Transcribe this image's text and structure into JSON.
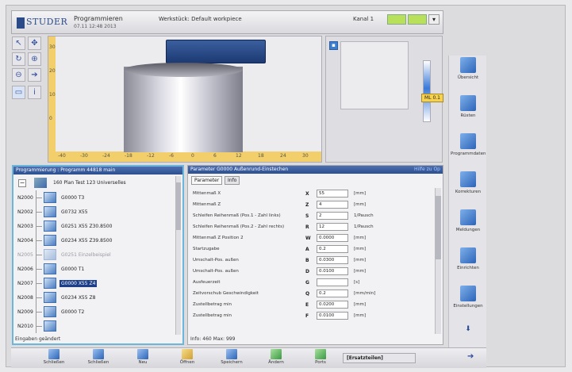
{
  "header": {
    "logo_text": "STUDER",
    "logo_sub": "",
    "title": "Programmieren",
    "date": "07.11 12:48 2013",
    "workpiece": "Werkstück: Default workpiece",
    "kanal": "Kanal 1",
    "green_btn_1": "",
    "green_btn_2": "",
    "dropdown": "▾"
  },
  "view": {
    "ruler_bottom_ticks": [
      "-40",
      "-30",
      "-24",
      "-18",
      "-12",
      "-6",
      "0",
      "6",
      "12",
      "18",
      "24",
      "30"
    ],
    "ruler_left_ticks": [
      "30",
      "20",
      "10",
      "0"
    ],
    "gauge_value": "ML 0.1"
  },
  "sidebar": {
    "items": [
      {
        "label": "Übersicht",
        "icon": "overview-icon"
      },
      {
        "label": "Rüsten",
        "icon": "setup-icon"
      },
      {
        "label": "Programmdaten",
        "icon": "program-data-icon"
      },
      {
        "label": "Korrekturen",
        "icon": "corrections-icon"
      },
      {
        "label": "Meldungen",
        "icon": "messages-icon"
      },
      {
        "label": "Einrichten",
        "icon": "configure-icon"
      },
      {
        "label": "Einstellungen",
        "icon": "settings-icon"
      }
    ],
    "down_arrow": "⬇"
  },
  "tree": {
    "title": "Programmierung : Programm 44818 main",
    "root_label": "160 Plan Test 123 Universelles",
    "rows": [
      {
        "num": "N2000",
        "label": "G0000 T3",
        "selected": false,
        "dim": false
      },
      {
        "num": "N2002",
        "label": "G0732 X55",
        "selected": false,
        "dim": false
      },
      {
        "num": "N2003",
        "label": "G0251 X55 Z30.8500",
        "selected": false,
        "dim": false
      },
      {
        "num": "N2004",
        "label": "G0234 X55 Z39.8500",
        "selected": false,
        "dim": false
      },
      {
        "num": "N2005",
        "label": "G0251 Einzelbeispiel",
        "selected": false,
        "dim": true
      },
      {
        "num": "N2006",
        "label": "G0000 T1",
        "selected": false,
        "dim": false
      },
      {
        "num": "N2007",
        "label": "G0000 X55 Z4",
        "selected": true,
        "dim": false
      },
      {
        "num": "N2008",
        "label": "G0234 X55 Z8",
        "selected": false,
        "dim": false
      },
      {
        "num": "N2009",
        "label": "G0000 T2",
        "selected": false,
        "dim": false
      },
      {
        "num": "N2010",
        "label": "",
        "selected": false,
        "dim": false
      }
    ],
    "status": "Eingaben geändert"
  },
  "params": {
    "title": "Parameter G0000 Außenrund-Einstechen",
    "link": "Hilfe zu Op",
    "tabs": [
      "Parameter",
      "Info"
    ],
    "rows": [
      {
        "name": "Mittenmaß X",
        "key": "X",
        "value": "55",
        "unit": "[mm]"
      },
      {
        "name": "Mittenmaß Z",
        "key": "Z",
        "value": "4",
        "unit": "[mm]"
      },
      {
        "name": "Schleifen Reihenmaß (Pos.1 - Zahl links)",
        "key": "S",
        "value": "2",
        "unit": "1/Pausch"
      },
      {
        "name": "Schleifen Reihenmaß (Pos.2 - Zahl rechts)",
        "key": "R",
        "value": "12",
        "unit": "1/Pausch"
      },
      {
        "name": "Mittenmaß Z Position 2",
        "key": "W",
        "value": "0.0000",
        "unit": "[mm]"
      },
      {
        "name": "Startzugabe",
        "key": "A",
        "value": "0.2",
        "unit": "[mm]"
      },
      {
        "name": "Umschalt-Pos. außen",
        "key": "B",
        "value": "0.0300",
        "unit": "[mm]"
      },
      {
        "name": "Umschalt-Pos. außen",
        "key": "D",
        "value": "0.0100",
        "unit": "[mm]"
      },
      {
        "name": "Ausfeuerzeit",
        "key": "G",
        "value": "",
        "unit": "[s]"
      },
      {
        "name": "Zeitvorschub Geschwindigkeit",
        "key": "Q",
        "value": "0.2",
        "unit": "[mm/min]"
      },
      {
        "name": "Zustellbetrag min",
        "key": "E",
        "value": "0.0200",
        "unit": "[mm]"
      },
      {
        "name": "Zustellbetrag min",
        "key": "F",
        "value": "0.0100",
        "unit": "[mm]"
      }
    ],
    "status": "Info: 460 Max: 999"
  },
  "toolbar": {
    "buttons": [
      {
        "label": "Schließen",
        "icon": "close-icon"
      },
      {
        "label": "Schließen",
        "icon": "close-file-icon"
      },
      {
        "label": "Neu",
        "icon": "new-icon"
      },
      {
        "label": "Öffnen",
        "icon": "open-icon"
      },
      {
        "label": "Speichern",
        "icon": "save-icon"
      },
      {
        "label": "Ändern",
        "icon": "edit-icon"
      },
      {
        "label": "Ports",
        "icon": "ports-icon"
      }
    ],
    "status": "[Ersatzteilen]",
    "next_arrow": "➔"
  }
}
